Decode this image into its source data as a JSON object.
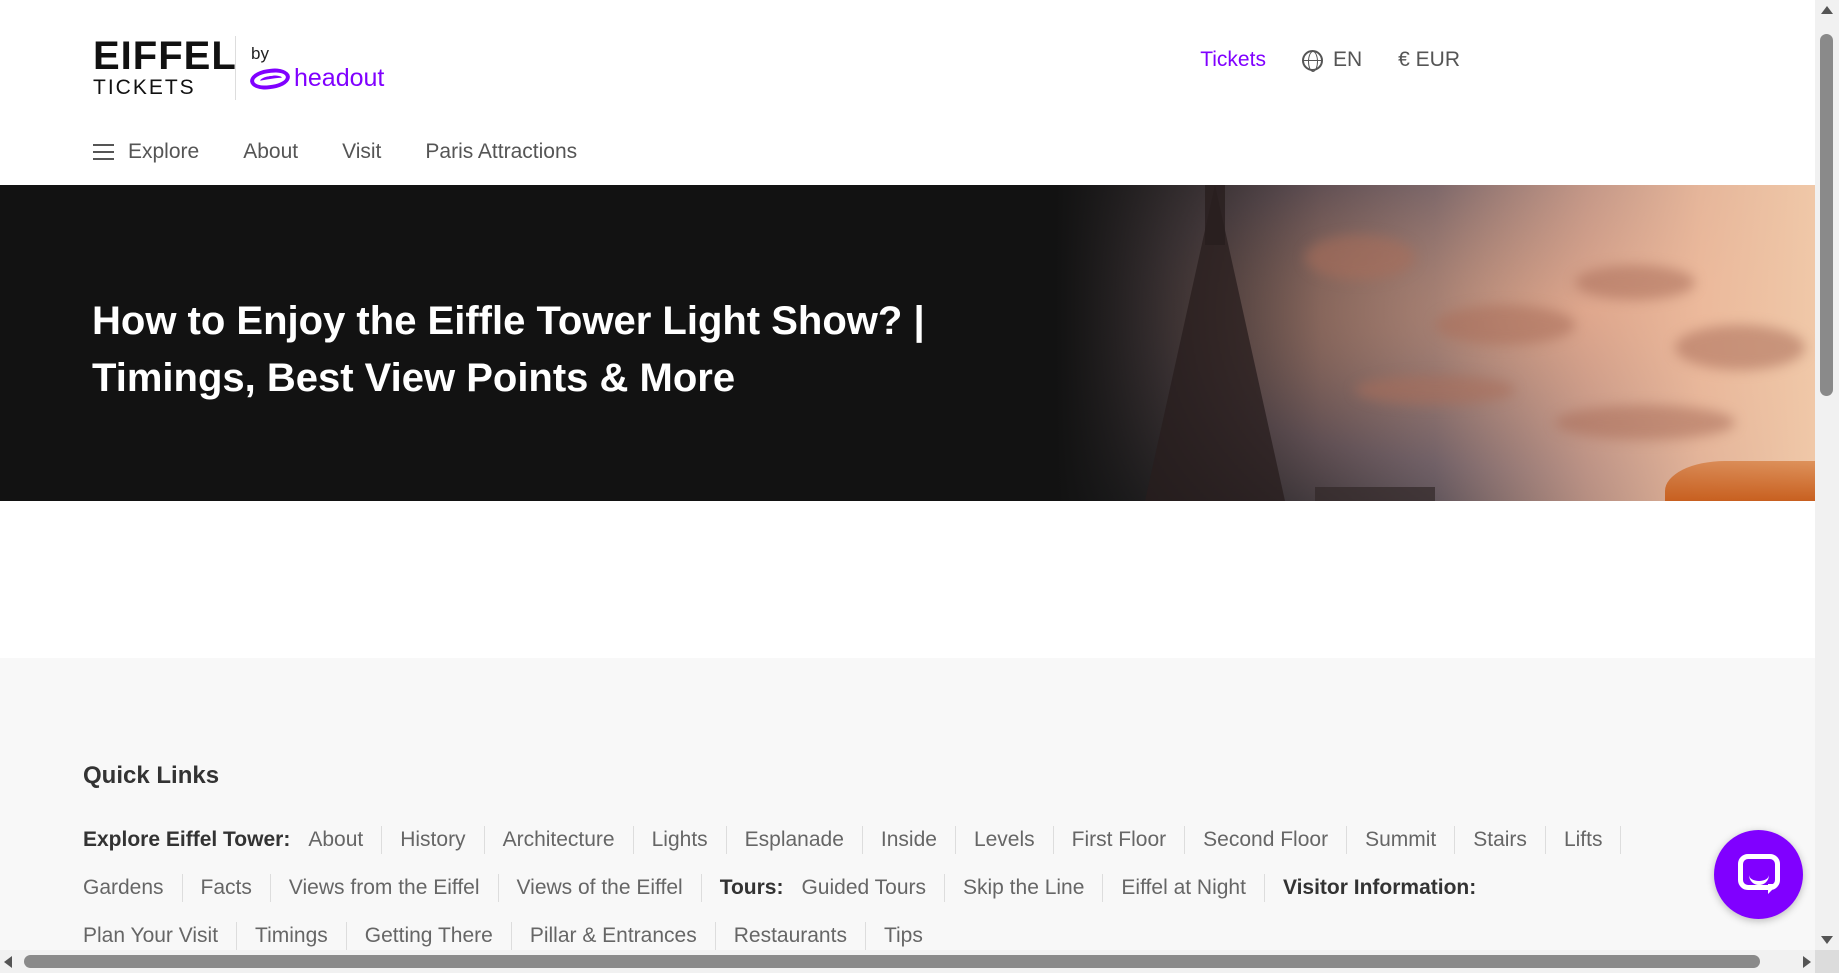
{
  "brand": {
    "logo_line1": "EIFFEL",
    "logo_line2": "TICKETS",
    "by": "by",
    "partner": "headout",
    "accent_color": "#8000ff"
  },
  "header": {
    "tickets_label": "Tickets",
    "language": "EN",
    "currency": "€ EUR"
  },
  "nav": {
    "items": [
      {
        "label": "Explore",
        "icon": "hamburger-menu-icon"
      },
      {
        "label": "About"
      },
      {
        "label": "Visit"
      },
      {
        "label": "Paris Attractions"
      }
    ]
  },
  "hero": {
    "title": "How to Enjoy the Eiffle Tower Light Show? | Timings, Best View Points & More"
  },
  "quick_links": {
    "title": "Quick Links",
    "groups": [
      {
        "heading": "Explore Eiffel Tower:",
        "links": [
          "About",
          "History",
          "Architecture",
          "Lights",
          "Esplanade",
          "Inside",
          "Levels",
          "First Floor",
          "Second Floor",
          "Summit",
          "Stairs",
          "Lifts",
          "Gardens",
          "Facts",
          "Views from the Eiffel",
          "Views of the Eiffel"
        ]
      },
      {
        "heading": "Tours:",
        "links": [
          "Guided Tours",
          "Skip the Line",
          "Eiffel at Night"
        ]
      },
      {
        "heading": "Visitor Information:",
        "links": [
          "Plan Your Visit",
          "Timings",
          "Getting There",
          "Pillar & Entrances",
          "Restaurants",
          "Tips"
        ]
      }
    ]
  },
  "chat": {
    "icon": "chat-icon"
  }
}
